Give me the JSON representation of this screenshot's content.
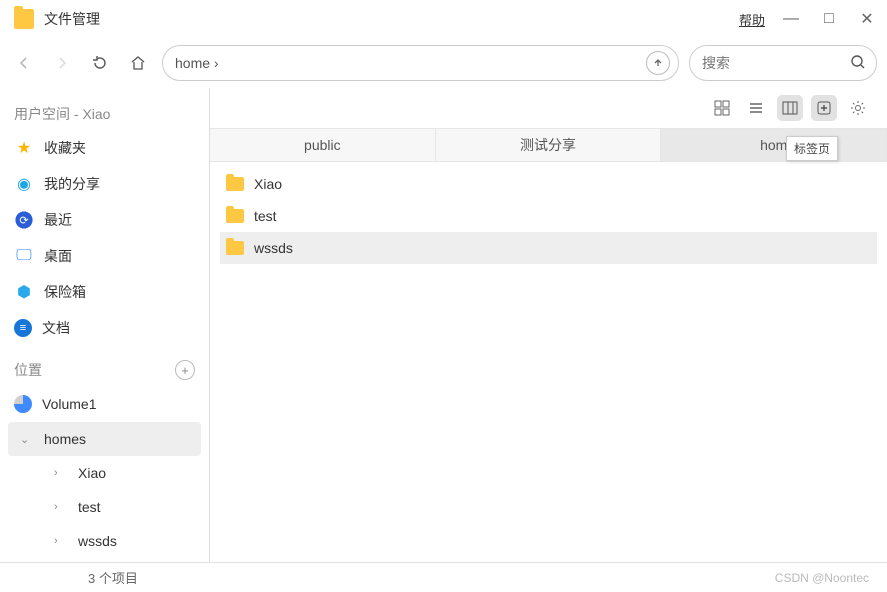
{
  "titlebar": {
    "title": "文件管理",
    "help": "帮助"
  },
  "toolbar": {
    "path": "home ›",
    "search_placeholder": "搜索"
  },
  "sidebar": {
    "user_header": "用户空间 - Xiao",
    "fav": "收藏夹",
    "share": "我的分享",
    "recent": "最近",
    "desktop": "桌面",
    "safe": "保险箱",
    "doc": "文档",
    "location_header": "位置",
    "volume": "Volume1",
    "tree": {
      "homes": "homes",
      "xiao": "Xiao",
      "test": "test",
      "wssds": "wssds"
    }
  },
  "tabs": {
    "t1": "public",
    "t2": "测试分享",
    "t3": "hom"
  },
  "tooltip": "标签页",
  "files": {
    "f1": "Xiao",
    "f2": "test",
    "f3": "wssds"
  },
  "status": {
    "count": "3 个项目",
    "watermark": "CSDN @Noontec"
  }
}
